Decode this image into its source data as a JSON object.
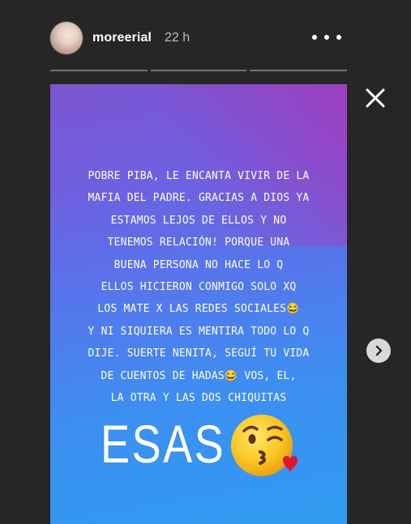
{
  "header": {
    "username": "moreerial",
    "timestamp": "22 h"
  },
  "progress_segments": 3,
  "story": {
    "text_lines": [
      "POBRE PIBA, LE ENCANTA VIVIR DE LA",
      "MAFIA DEL PADRE. GRACIAS A DIOS YA",
      "ESTAMOS LEJOS DE ELLOS Y NO",
      "TENEMOS RELACIÓN! PORQUE UNA",
      "BUENA PERSONA NO HACE LO Q",
      "ELLOS HICIERON CONMIGO SOLO XQ",
      "LOS MATE X LAS REDES SOCIALES😂",
      "Y NI SIQUIERA ES MENTIRA TODO LO Q",
      "DIJE. SUERTE NENITA, SEGUÍ TU VIDA",
      "DE CUENTOS DE HADAS😂 VOS, EL,",
      "LA OTRA Y LAS DOS CHIQUITAS"
    ],
    "big_word": "ESAS",
    "big_emoji": "kissing-face-with-heart"
  },
  "icons": {
    "more": "more-horizontal-icon",
    "close": "close-icon",
    "next": "chevron-right-icon"
  }
}
